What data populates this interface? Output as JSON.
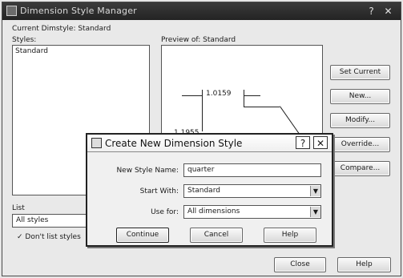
{
  "window": {
    "title": "Dimension Style Manager",
    "help_glyph": "?",
    "close_glyph": "✕"
  },
  "current_dimstyle_label": "Current Dimstyle: Standard",
  "styles": {
    "label": "Styles:",
    "items": [
      "Standard"
    ]
  },
  "preview": {
    "label": "Preview of: Standard",
    "dim1": "1.0159",
    "dim2": "1.1955"
  },
  "list": {
    "label": "List",
    "value": "All styles",
    "dont_list_label": "Don't list styles"
  },
  "side_buttons": {
    "set_current": "Set Current",
    "new": "New...",
    "modify": "Modify...",
    "override": "Override...",
    "compare": "Compare..."
  },
  "bottom_buttons": {
    "close": "Close",
    "help": "Help"
  },
  "dialog": {
    "title": "Create New Dimension Style",
    "help_glyph": "?",
    "close_glyph": "✕",
    "new_style_name_label": "New Style Name:",
    "new_style_name_value": "quarter",
    "start_with_label": "Start With:",
    "start_with_value": "Standard",
    "use_for_label": "Use for:",
    "use_for_value": "All dimensions",
    "continue": "Continue",
    "cancel": "Cancel",
    "help": "Help"
  }
}
